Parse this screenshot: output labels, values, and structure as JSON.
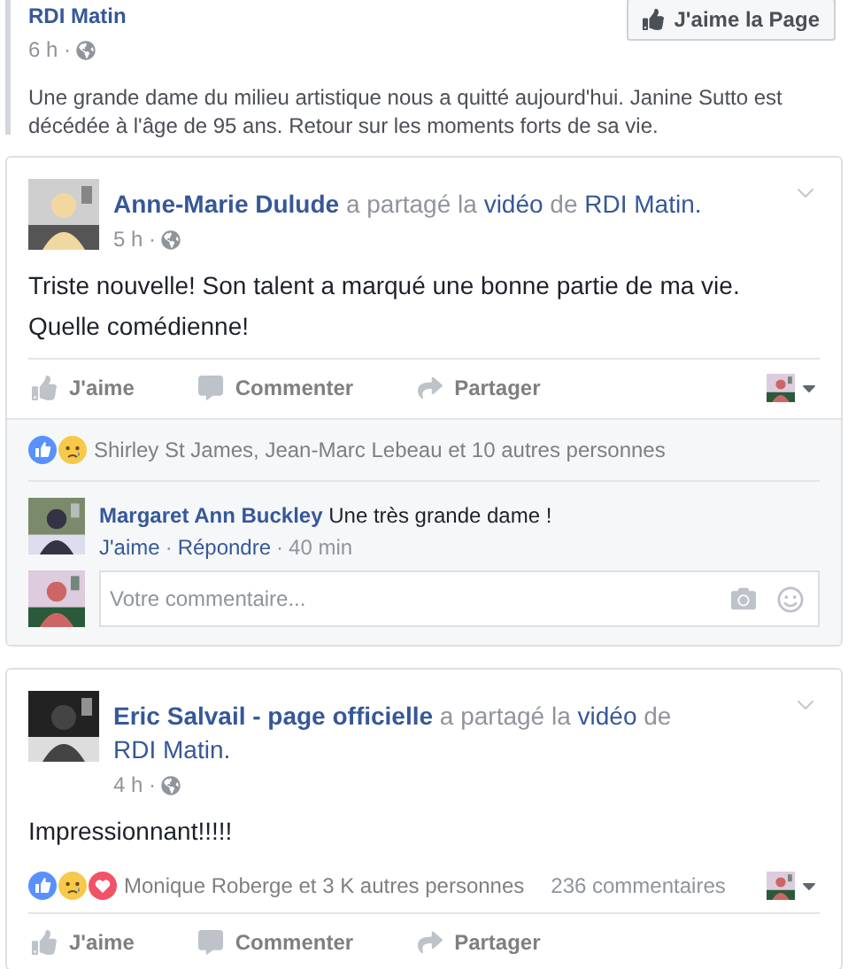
{
  "page_post": {
    "author": "RDI Matin",
    "time": "6 h ·",
    "like_page_button": "J'aime la Page",
    "text": "Une grande dame du milieu artistique nous a quitté aujourd'hui. Janine Sutto est décédée à l'âge de 95 ans. Retour sur les moments forts de sa vie."
  },
  "posts": [
    {
      "kind": "with_comments",
      "author": "Anne-Marie Dulude",
      "shared_prefix": "a partagé la",
      "shared_link": "vidéo",
      "shared_mid": "de",
      "shared_page": "RDI Matin.",
      "time": "5 h ·",
      "text": "Triste nouvelle! Son talent a marqué une bonne partie de ma vie. Quelle comédienne!",
      "actions": [
        "J'aime",
        "Commenter",
        "Partager"
      ],
      "reactions": [
        {
          "kind": "like"
        },
        {
          "kind": "sad"
        }
      ],
      "reaction_summary": "Shirley St James, Jean-Marc Lebeau et 10 autres personnes",
      "comments": [
        {
          "author": "Margaret Ann Buckley",
          "text": "Une très grande dame !",
          "actions": [
            "J'aime",
            "Répondre"
          ],
          "separator": "·",
          "time": "40 min"
        }
      ],
      "comment_placeholder": "Votre commentaire..."
    },
    {
      "kind": "summary",
      "author": "Eric Salvail - page officielle",
      "shared_prefix": "a partagé la",
      "shared_link": "vidéo",
      "shared_mid": "de",
      "shared_page": "RDI Matin.",
      "time": "4 h ·",
      "text": "Impressionnant!!!!!",
      "reactions": [
        {
          "kind": "like"
        },
        {
          "kind": "sad"
        },
        {
          "kind": "love"
        }
      ],
      "reaction_summary": "Monique Roberge et 3 K autres personnes",
      "comment_count": "236 commentaires",
      "actions": [
        "J'aime",
        "Commenter",
        "Partager"
      ]
    }
  ]
}
